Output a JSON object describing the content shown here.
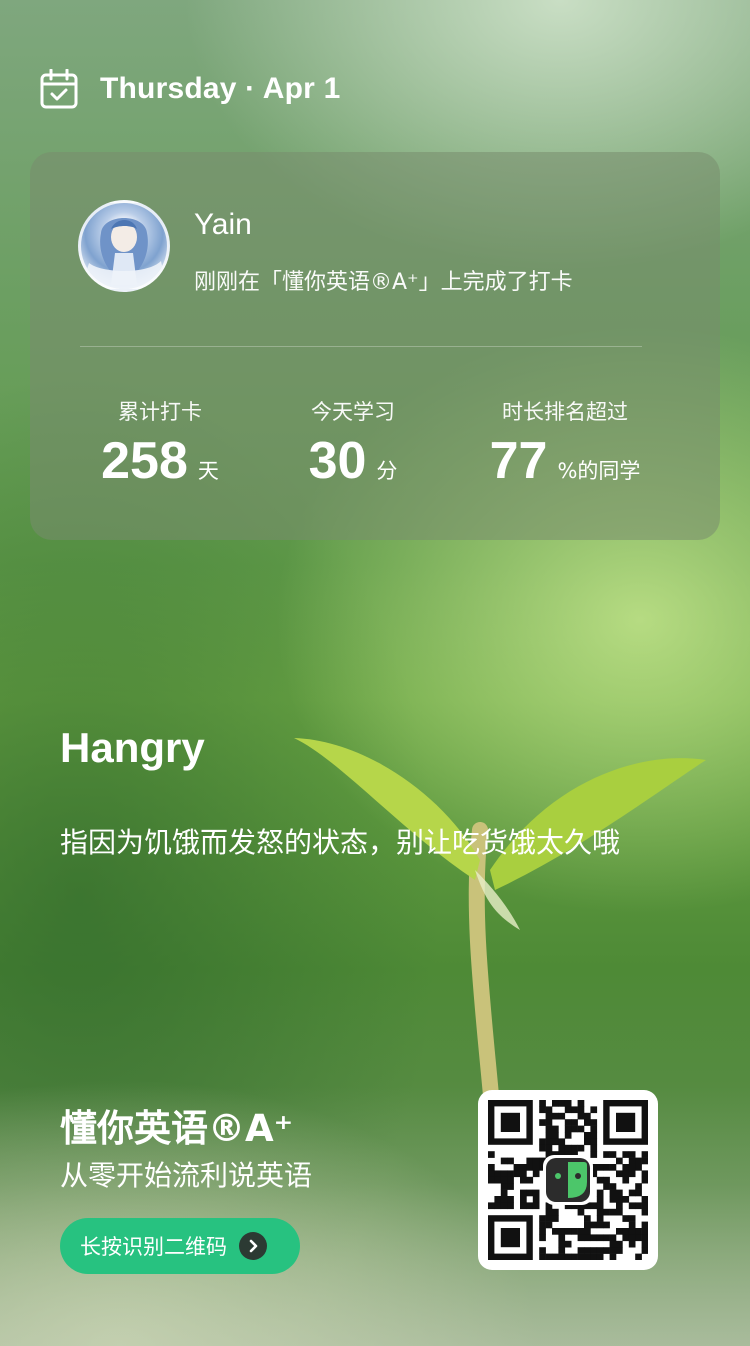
{
  "header": {
    "date": "Thursday · Apr 1"
  },
  "card": {
    "username": "Yain",
    "checkin_text": "刚刚在「懂你英语®A⁺」上完成了打卡",
    "stats": [
      {
        "label": "累计打卡",
        "value": "258",
        "unit": "天"
      },
      {
        "label": "今天学习",
        "value": "30",
        "unit": "分"
      },
      {
        "label": "时长排名超过",
        "value": "77",
        "unit": "%的同学"
      }
    ]
  },
  "word": {
    "term": "Hangry",
    "meaning": "指因为饥饿而发怒的状态，别让吃货饿太久哦"
  },
  "footer": {
    "brand": "懂你英语®A⁺",
    "tagline": "从零开始流利说英语",
    "cta_label": "长按识别二维码"
  },
  "icons": {
    "calendar": "calendar-check-icon",
    "arrow": "chevron-right-icon",
    "qr": "qr-code"
  },
  "colors": {
    "cta_green": "#27c280",
    "logo_green": "#4cc66a"
  }
}
